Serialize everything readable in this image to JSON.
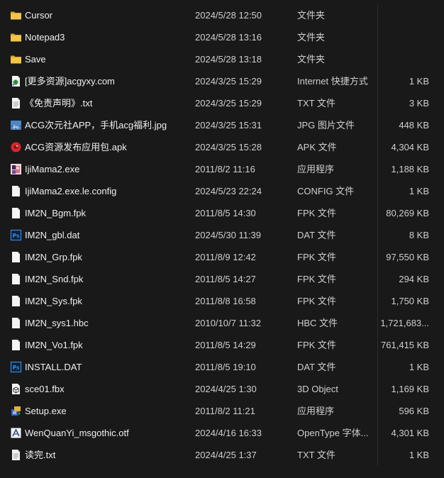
{
  "files": [
    {
      "icon": "folder-icon",
      "name": "Cursor",
      "date": "2024/5/28 12:50",
      "type": "文件夹",
      "size": ""
    },
    {
      "icon": "folder-icon",
      "name": "Notepad3",
      "date": "2024/5/28 13:16",
      "type": "文件夹",
      "size": ""
    },
    {
      "icon": "folder-icon",
      "name": "Save",
      "date": "2024/5/28 13:18",
      "type": "文件夹",
      "size": ""
    },
    {
      "icon": "internet-shortcut-icon",
      "name": "[更多资源]acgyxy.com",
      "date": "2024/3/25 15:29",
      "type": "Internet 快捷方式",
      "size": "1 KB"
    },
    {
      "icon": "text-file-icon",
      "name": "《免责声明》.txt",
      "date": "2024/3/25 15:29",
      "type": "TXT 文件",
      "size": "3 KB"
    },
    {
      "icon": "jpg-image-icon",
      "name": "ACG次元社APP，手机acg福利.jpg",
      "date": "2024/3/25 15:31",
      "type": "JPG 图片文件",
      "size": "448 KB"
    },
    {
      "icon": "apk-package-icon",
      "name": "ACG资源发布应用包.apk",
      "date": "2024/3/25 15:28",
      "type": "APK 文件",
      "size": "4,304 KB"
    },
    {
      "icon": "app-exe-icon",
      "name": "IjiMama2.exe",
      "date": "2011/8/2 11:16",
      "type": "应用程序",
      "size": "1,188 KB"
    },
    {
      "icon": "blank-file-icon",
      "name": "IjiMama2.exe.le.config",
      "date": "2024/5/23 22:24",
      "type": "CONFIG 文件",
      "size": "1 KB"
    },
    {
      "icon": "blank-file-icon",
      "name": "IM2N_Bgm.fpk",
      "date": "2011/8/5 14:30",
      "type": "FPK 文件",
      "size": "80,269 KB"
    },
    {
      "icon": "ps-file-icon",
      "name": "IM2N_gbl.dat",
      "date": "2024/5/30 11:39",
      "type": "DAT 文件",
      "size": "8 KB"
    },
    {
      "icon": "blank-file-icon",
      "name": "IM2N_Grp.fpk",
      "date": "2011/8/9 12:42",
      "type": "FPK 文件",
      "size": "97,550 KB"
    },
    {
      "icon": "blank-file-icon",
      "name": "IM2N_Snd.fpk",
      "date": "2011/8/5 14:27",
      "type": "FPK 文件",
      "size": "294 KB"
    },
    {
      "icon": "blank-file-icon",
      "name": "IM2N_Sys.fpk",
      "date": "2011/8/8 16:58",
      "type": "FPK 文件",
      "size": "1,750 KB"
    },
    {
      "icon": "blank-file-icon",
      "name": "IM2N_sys1.hbc",
      "date": "2010/10/7 11:32",
      "type": "HBC 文件",
      "size": "1,721,683..."
    },
    {
      "icon": "blank-file-icon",
      "name": "IM2N_Vo1.fpk",
      "date": "2011/8/5 14:29",
      "type": "FPK 文件",
      "size": "761,415 KB"
    },
    {
      "icon": "ps-file-icon",
      "name": "INSTALL.DAT",
      "date": "2011/8/5 19:10",
      "type": "DAT 文件",
      "size": "1 KB"
    },
    {
      "icon": "3d-object-icon",
      "name": "sce01.fbx",
      "date": "2024/4/25 1:30",
      "type": "3D Object",
      "size": "1,169 KB"
    },
    {
      "icon": "setup-exe-icon",
      "name": "Setup.exe",
      "date": "2011/8/2 11:21",
      "type": "应用程序",
      "size": "596 KB"
    },
    {
      "icon": "font-file-icon",
      "name": "WenQuanYi_msgothic.otf",
      "date": "2024/4/16 16:33",
      "type": "OpenType 字体...",
      "size": "4,301 KB"
    },
    {
      "icon": "text-file-icon",
      "name": "读完.txt",
      "date": "2024/4/25 1:37",
      "type": "TXT 文件",
      "size": "1 KB"
    }
  ],
  "colors": {
    "background": "#191919",
    "text": "#e6e6e6",
    "folder": "#e8b73a",
    "ps_blue": "#2b8ee8"
  }
}
